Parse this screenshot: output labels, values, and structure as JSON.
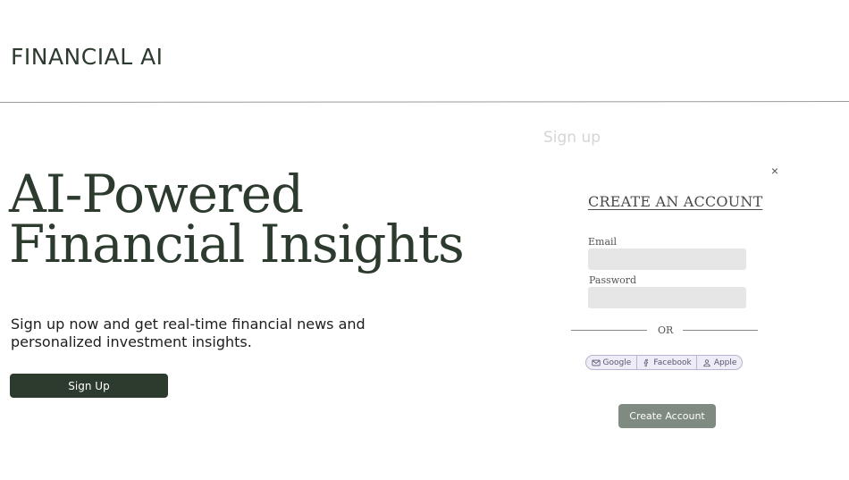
{
  "header": {
    "brand": "FINANCIAL AI"
  },
  "hero": {
    "title_line1": "AI-Powered",
    "title_line2": "Financial Insights",
    "subtitle": "Sign up now and get real-time financial news and personalized investment insights.",
    "cta_label": "Sign Up"
  },
  "modal": {
    "title": "Sign up",
    "close_symbol": "×",
    "heading": "CREATE AN ACCOUNT",
    "email_label": "Email",
    "email_value": "",
    "password_label": "Password",
    "password_value": "",
    "divider_text": "OR",
    "social": [
      {
        "label": "Google",
        "icon": "mail-icon"
      },
      {
        "label": "Facebook",
        "icon": "facebook-icon"
      },
      {
        "label": "Apple",
        "icon": "user-icon"
      }
    ],
    "submit_label": "Create Account"
  },
  "colors": {
    "brand_dark": "#2d3a2e",
    "submit_muted": "#7f8a80",
    "social_bg": "#eeecf6",
    "input_bg": "#e6e6e6"
  }
}
